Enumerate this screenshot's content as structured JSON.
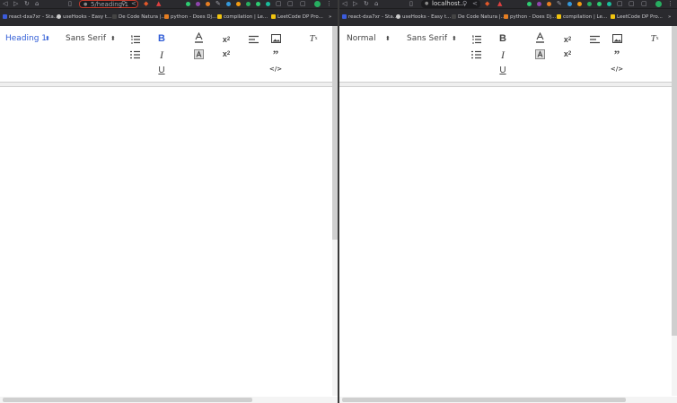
{
  "left": {
    "nav": {
      "url": "5/heading-1"
    },
    "bookmarks": [
      "react-dxa7xr - Sta...",
      "useHooks - Easy t...",
      "De Code Natura |...",
      "python - Does Dj...",
      "compilation | Le...",
      "LeetCode DP Pro..."
    ],
    "toolbar": {
      "header_value": "Heading 1",
      "font_value": "Sans Serif",
      "bold": "B",
      "italic": "I",
      "underline": "U",
      "sub_label": "x",
      "sub_mark": "2",
      "sup_label": "x",
      "sup_mark": "2",
      "quote": "”",
      "code": "</>",
      "clean_label": "T",
      "clean_mark": "x"
    }
  },
  "right": {
    "nav": {
      "url": "localhost..."
    },
    "bookmarks": [
      "react-dxa7xr - Sta...",
      "useHooks - Easy t...",
      "De Code Natura |...",
      "python - Does Dj...",
      "compilation | Le...",
      "LeetCode DP Pro..."
    ],
    "toolbar": {
      "header_value": "Normal",
      "font_value": "Sans Serif",
      "bold": "B",
      "italic": "I",
      "underline": "U",
      "sub_label": "x",
      "sub_mark": "2",
      "sup_label": "x",
      "sup_mark": "2",
      "quote": "”",
      "code": "</>",
      "clean_label": "T",
      "clean_mark": "x"
    }
  },
  "colors": {
    "active": "#2f5cd6",
    "icon": "#444444",
    "chrome": "#2a2a2e"
  },
  "icons": [
    "back-icon",
    "forward-icon",
    "reload-icon",
    "home-icon",
    "bookmark-icon",
    "zoom-icon",
    "share-icon",
    "shield-icon",
    "extension-icon"
  ]
}
